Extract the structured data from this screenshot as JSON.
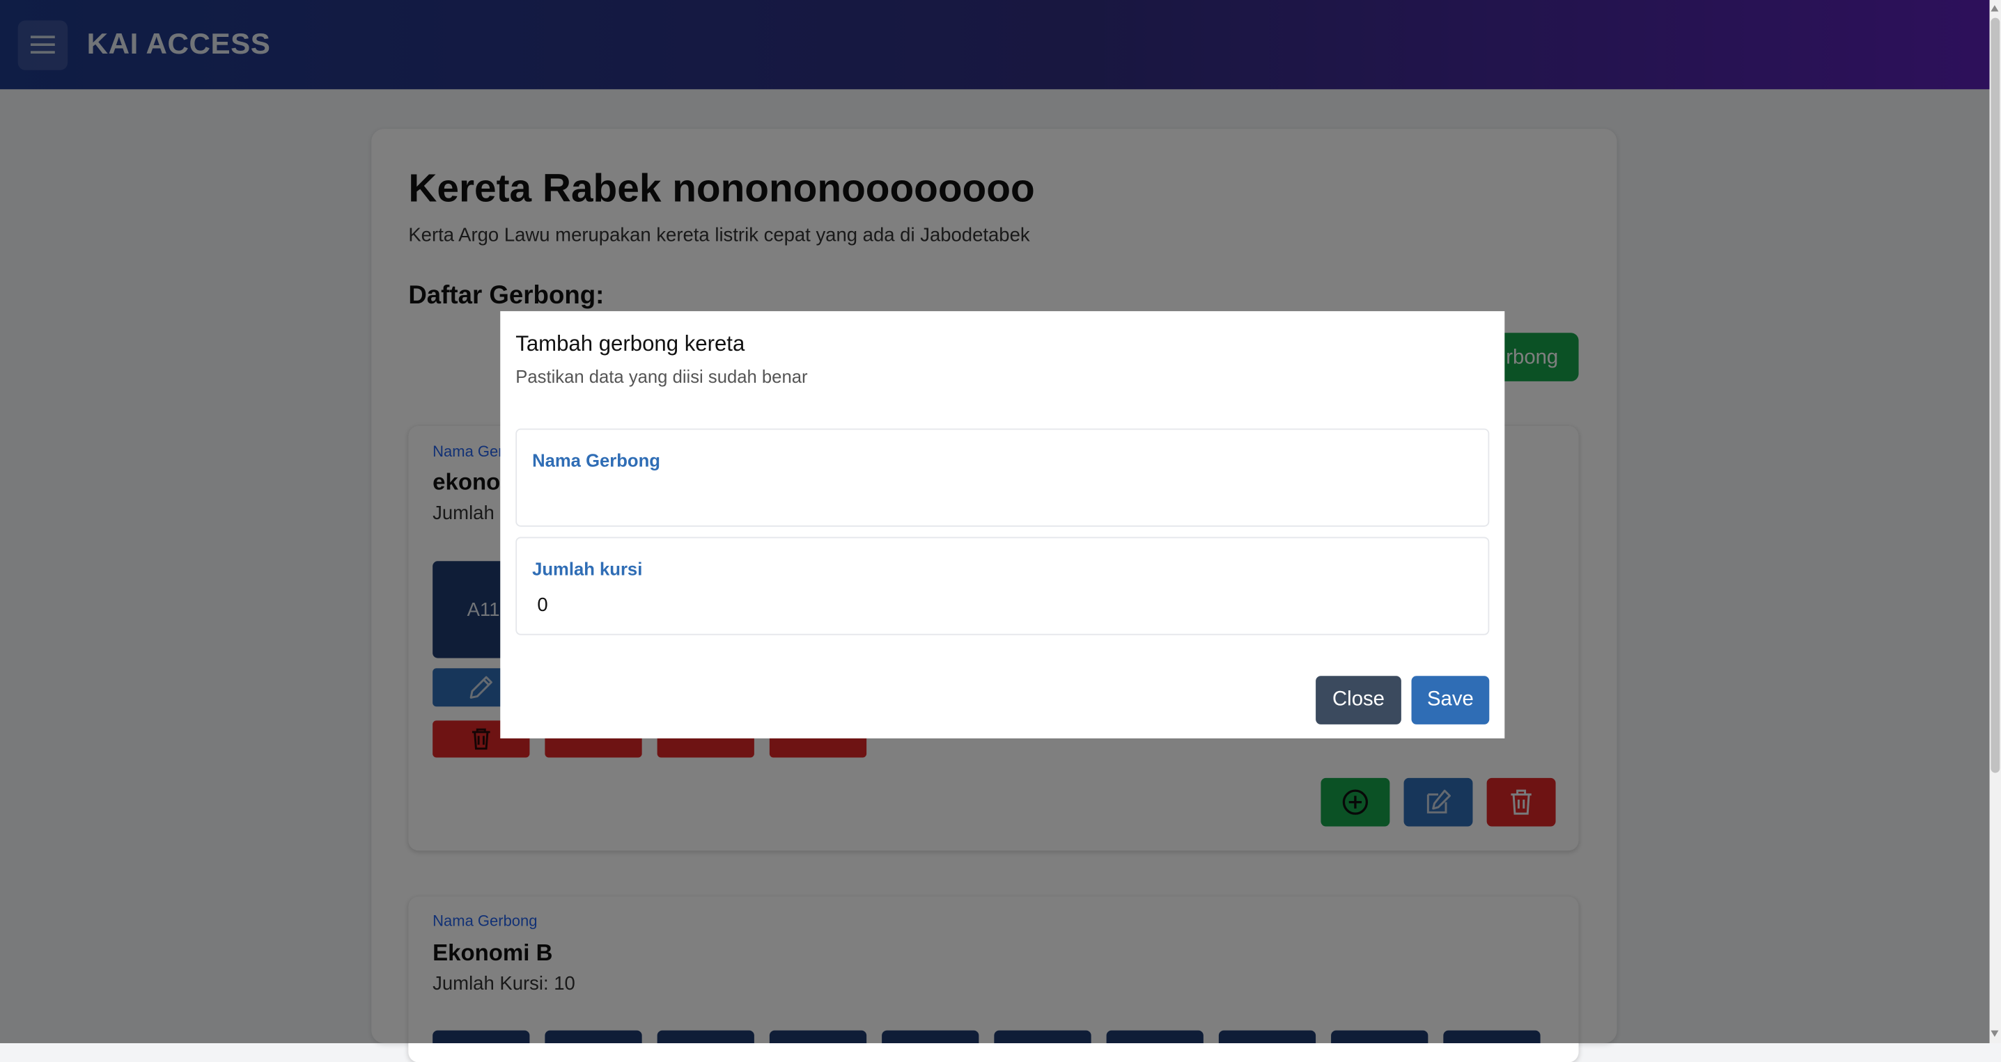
{
  "navbar": {
    "brand": "KAI ACCESS"
  },
  "train": {
    "title": "Kereta Rabek nonononoooooooo",
    "description": "Kerta Argo Lawu merupakan kereta listrik cepat yang ada di Jabodetabek",
    "section_heading": "Daftar Gerbong:",
    "add_gerbong_partial": "rbong"
  },
  "gerbong_cards": [
    {
      "label_partial": "Nama Ger",
      "name_partial": "ekonon",
      "count_partial": "Jumlah",
      "first_seat": "A11"
    },
    {
      "label": "Nama Gerbong",
      "name": "Ekonomi B",
      "count": "Jumlah Kursi: 10"
    }
  ],
  "modal": {
    "title": "Tambah gerbong kereta",
    "subtitle": "Pastikan data yang diisi sudah benar",
    "fields": [
      {
        "label": "Nama Gerbong",
        "value": ""
      },
      {
        "label": "Jumlah kursi",
        "value": "0"
      }
    ],
    "close_label": "Close",
    "save_label": "Save"
  },
  "icons": [
    "menu-icon",
    "pencil-icon",
    "trash-icon",
    "plus-circle-icon",
    "edit-icon"
  ],
  "colors": {
    "primary": "#2f6db5",
    "success": "#16a34a",
    "danger": "#dc2626",
    "dark": "#3b4a5e"
  }
}
